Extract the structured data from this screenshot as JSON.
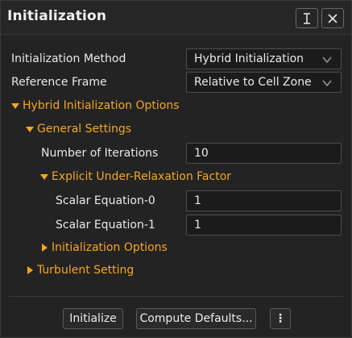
{
  "window": {
    "title": "Initialization",
    "pin_icon": "text-cursor-icon",
    "close_icon": "close-icon"
  },
  "form": {
    "init_method_label": "Initialization Method",
    "init_method_value": "Hybrid Initialization",
    "reference_frame_label": "Reference Frame",
    "reference_frame_value": "Relative to Cell Zone",
    "hybrid_options_label": "Hybrid Initialization Options",
    "general_settings_label": "General Settings",
    "num_iterations_label": "Number of Iterations",
    "num_iterations_value": "10",
    "explicit_urf_label": "Explicit Under-Relaxation Factor",
    "scalar0_label": "Scalar Equation-0",
    "scalar0_value": "1",
    "scalar1_label": "Scalar Equation-1",
    "scalar1_value": "1",
    "init_options_label": "Initialization Options",
    "turbulent_setting_label": "Turbulent Setting"
  },
  "footer": {
    "initialize_label": "Initialize",
    "compute_defaults_label": "Compute Defaults...",
    "more_label": "⋮"
  },
  "colors": {
    "accent": "#f5a623",
    "background": "#232323"
  }
}
